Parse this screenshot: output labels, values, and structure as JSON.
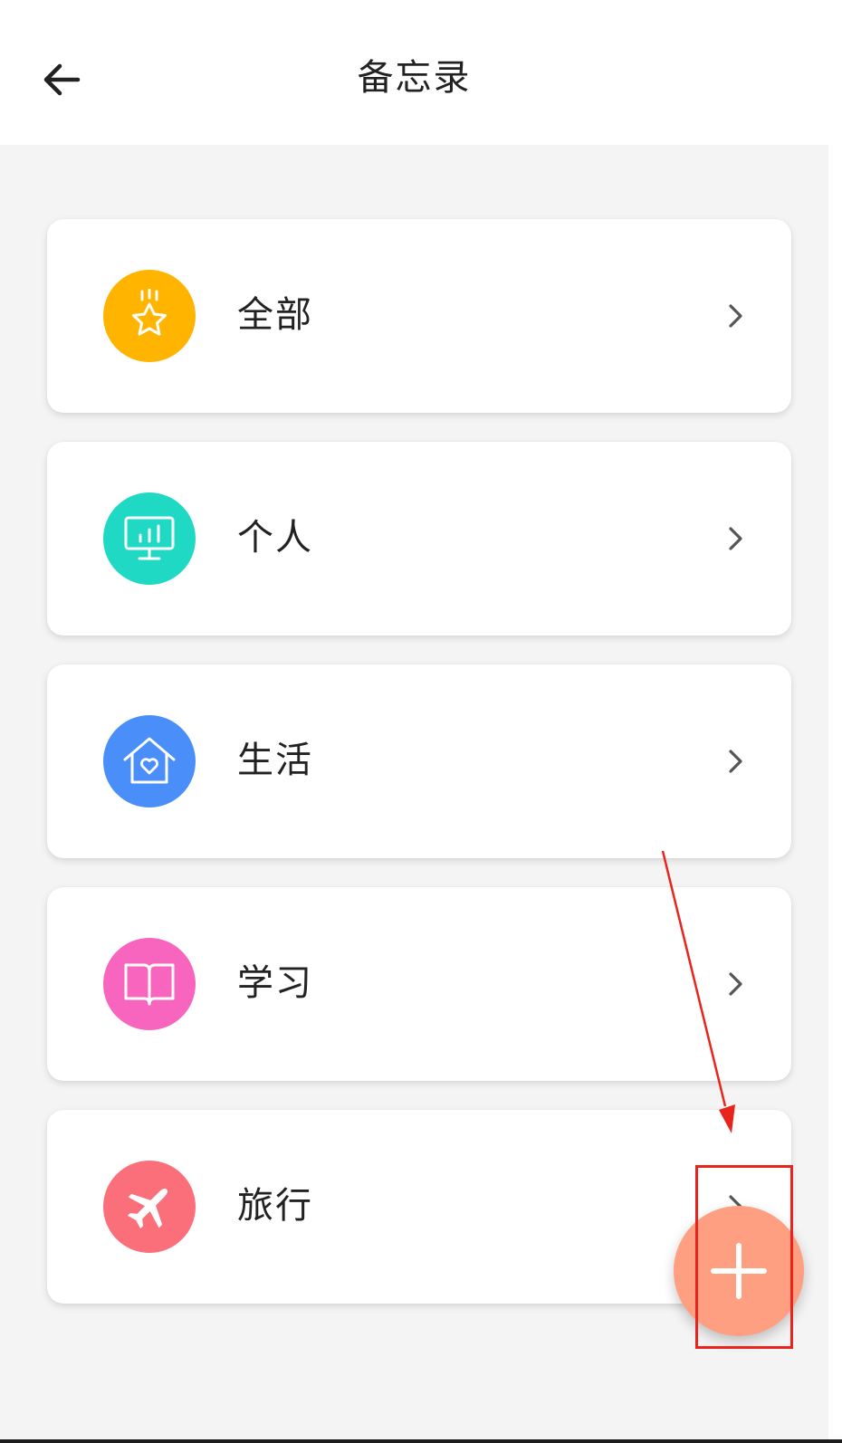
{
  "header": {
    "title": "备忘录",
    "back_icon": "arrow-left-icon"
  },
  "categories": [
    {
      "label": "全部",
      "icon": "star-icon",
      "color": "#ffb400"
    },
    {
      "label": "个人",
      "icon": "monitor-chart-icon",
      "color": "#1fd9c4"
    },
    {
      "label": "生活",
      "icon": "home-heart-icon",
      "color": "#4a8ef9"
    },
    {
      "label": "学习",
      "icon": "book-icon",
      "color": "#f865be"
    },
    {
      "label": "旅行",
      "icon": "airplane-icon",
      "color": "#fb6f7a"
    }
  ],
  "fab": {
    "icon": "plus-icon",
    "color": "#ff9f82"
  },
  "annotation": {
    "color": "#e8241c"
  }
}
